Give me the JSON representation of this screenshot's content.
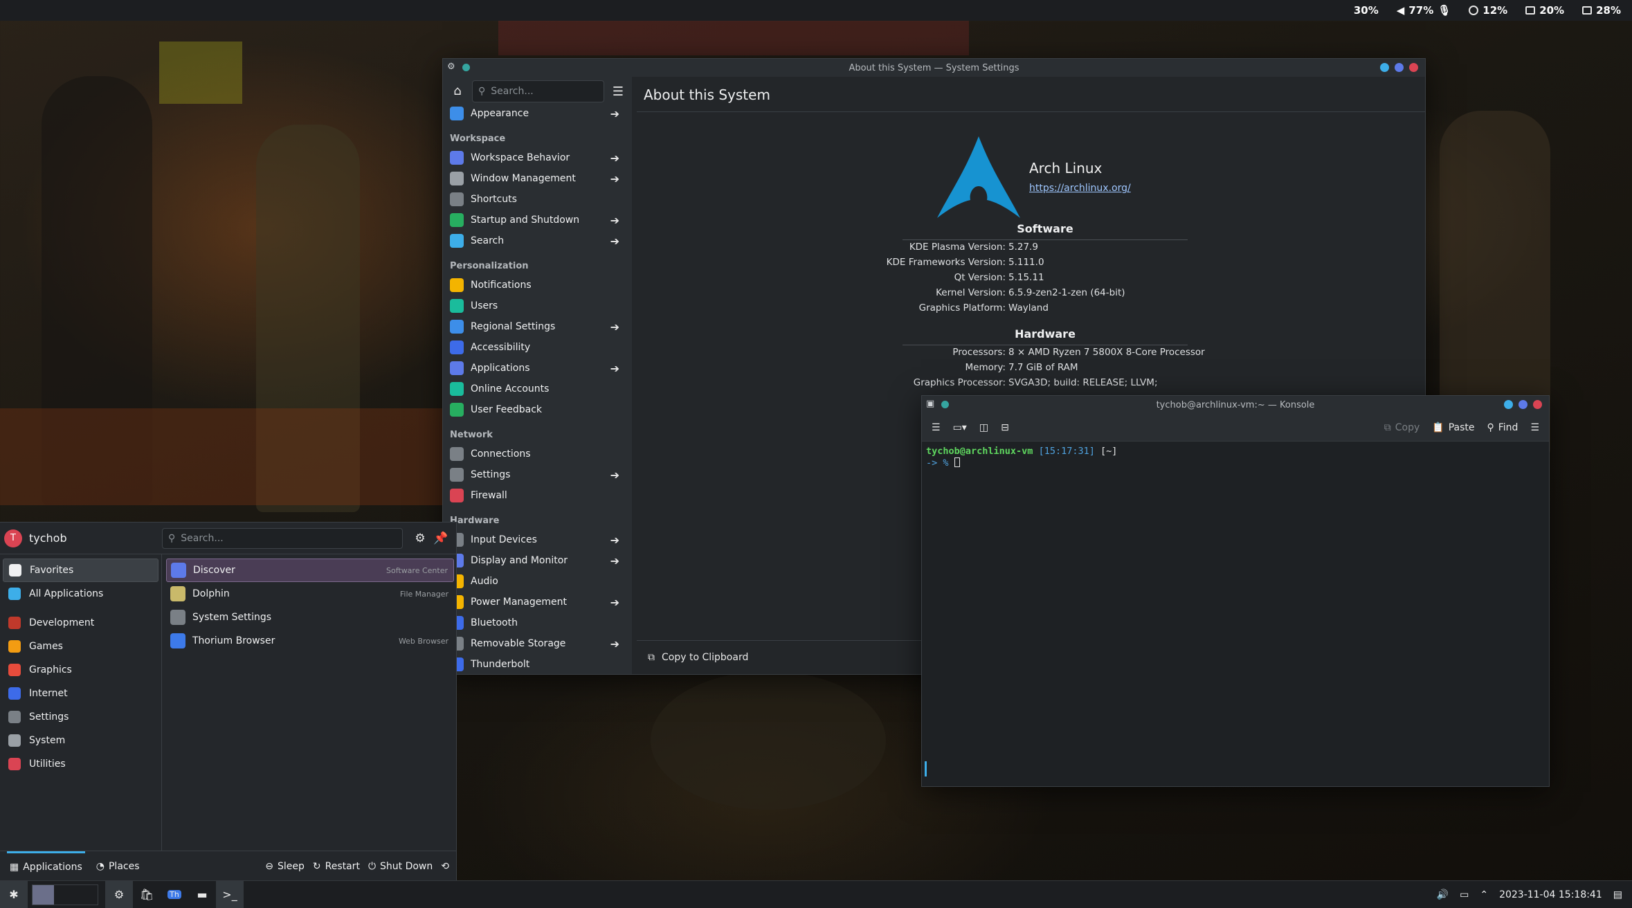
{
  "topbar": {
    "items": [
      {
        "icon": "volume-icon",
        "text": "30%"
      },
      {
        "icon": "speaker-icon",
        "text": "77%"
      },
      {
        "icon": "mic-icon",
        "text": ""
      },
      {
        "icon": "cpu-icon",
        "text": "12%"
      },
      {
        "icon": "memory-icon",
        "text": "20%"
      },
      {
        "icon": "disk-icon",
        "text": "28%"
      }
    ]
  },
  "settings": {
    "window_title": "About this System — System Settings",
    "search_placeholder": "Search...",
    "page_title": "About this System",
    "sidebar": {
      "top_item": "Appearance",
      "sections": [
        {
          "title": "Workspace",
          "items": [
            {
              "label": "Workspace Behavior",
              "arrow": true,
              "color": "#5d7ae9"
            },
            {
              "label": "Window Management",
              "arrow": true,
              "color": "#9aa0a6"
            },
            {
              "label": "Shortcuts",
              "arrow": false,
              "color": "#7a8086"
            },
            {
              "label": "Startup and Shutdown",
              "arrow": true,
              "color": "#27ae60"
            },
            {
              "label": "Search",
              "arrow": true,
              "color": "#3daee9"
            }
          ]
        },
        {
          "title": "Personalization",
          "items": [
            {
              "label": "Notifications",
              "arrow": false,
              "color": "#f4b400"
            },
            {
              "label": "Users",
              "arrow": false,
              "color": "#1abc9c"
            },
            {
              "label": "Regional Settings",
              "arrow": true,
              "color": "#3d8ee9"
            },
            {
              "label": "Accessibility",
              "arrow": false,
              "color": "#3d6be9"
            },
            {
              "label": "Applications",
              "arrow": true,
              "color": "#5d7ae9"
            },
            {
              "label": "Online Accounts",
              "arrow": false,
              "color": "#1abc9c"
            },
            {
              "label": "User Feedback",
              "arrow": false,
              "color": "#27ae60"
            }
          ]
        },
        {
          "title": "Network",
          "items": [
            {
              "label": "Connections",
              "arrow": false,
              "color": "#7a8086"
            },
            {
              "label": "Settings",
              "arrow": true,
              "color": "#7a8086"
            },
            {
              "label": "Firewall",
              "arrow": false,
              "color": "#da4453"
            }
          ]
        },
        {
          "title": "Hardware",
          "items": [
            {
              "label": "Input Devices",
              "arrow": true,
              "color": "#7a8086"
            },
            {
              "label": "Display and Monitor",
              "arrow": true,
              "color": "#5d7ae9"
            },
            {
              "label": "Audio",
              "arrow": false,
              "color": "#f4b400"
            },
            {
              "label": "Power Management",
              "arrow": true,
              "color": "#f4b400"
            },
            {
              "label": "Bluetooth",
              "arrow": false,
              "color": "#3d6be9"
            },
            {
              "label": "Removable Storage",
              "arrow": true,
              "color": "#7a8086"
            },
            {
              "label": "Thunderbolt",
              "arrow": false,
              "color": "#3d6be9"
            }
          ]
        }
      ]
    },
    "about": {
      "distro": "Arch Linux",
      "url": "https://archlinux.org/",
      "software_title": "Software",
      "software": [
        {
          "k": "KDE Plasma Version:",
          "v": "5.27.9"
        },
        {
          "k": "KDE Frameworks Version:",
          "v": "5.111.0"
        },
        {
          "k": "Qt Version:",
          "v": "5.15.11"
        },
        {
          "k": "Kernel Version:",
          "v": "6.5.9-zen2-1-zen (64-bit)"
        },
        {
          "k": "Graphics Platform:",
          "v": "Wayland"
        }
      ],
      "hardware_title": "Hardware",
      "hardware": [
        {
          "k": "Processors:",
          "v": "8 × AMD Ryzen 7 5800X 8-Core Processor"
        },
        {
          "k": "Memory:",
          "v": "7.7 GiB of RAM"
        },
        {
          "k": "Graphics Processor:",
          "v": "SVGA3D; build: RELEASE; LLVM;"
        }
      ],
      "copy_label": "Copy to Clipboard"
    }
  },
  "konsole": {
    "window_title": "tychob@archlinux-vm:~ — Konsole",
    "copy": "Copy",
    "paste": "Paste",
    "find": "Find",
    "prompt_user": "tychob@archlinux-vm",
    "prompt_time": "[15:17:31]",
    "prompt_dir": "[~]",
    "prompt_arrow": "-> %"
  },
  "launcher": {
    "user": "tychob",
    "avatar_letter": "T",
    "search_placeholder": "Search...",
    "categories": [
      {
        "label": "Favorites",
        "color": "#eff0f1",
        "active": true
      },
      {
        "label": "All Applications",
        "color": "#3daee9",
        "active": false
      },
      {
        "label": "Development",
        "color": "#c0392b",
        "active": false
      },
      {
        "label": "Games",
        "color": "#f39c12",
        "active": false
      },
      {
        "label": "Graphics",
        "color": "#e74c3c",
        "active": false
      },
      {
        "label": "Internet",
        "color": "#3d6be9",
        "active": false
      },
      {
        "label": "Settings",
        "color": "#7a8086",
        "active": false
      },
      {
        "label": "System",
        "color": "#9aa0a6",
        "active": false
      },
      {
        "label": "Utilities",
        "color": "#da4453",
        "active": false
      }
    ],
    "apps": [
      {
        "name": "Discover",
        "desc": "Software Center",
        "color": "#5d7ae9",
        "active": true
      },
      {
        "name": "Dolphin",
        "desc": "File Manager",
        "color": "#c9b96a",
        "active": false
      },
      {
        "name": "System Settings",
        "desc": "",
        "color": "#7a8086",
        "active": false
      },
      {
        "name": "Thorium Browser",
        "desc": "Web Browser",
        "color": "#3d7ae9",
        "active": false
      }
    ],
    "footer": {
      "applications": "Applications",
      "places": "Places",
      "sleep": "Sleep",
      "restart": "Restart",
      "shutdown": "Shut Down"
    }
  },
  "taskbar": {
    "datetime": "2023-11-04 15:18:41"
  }
}
